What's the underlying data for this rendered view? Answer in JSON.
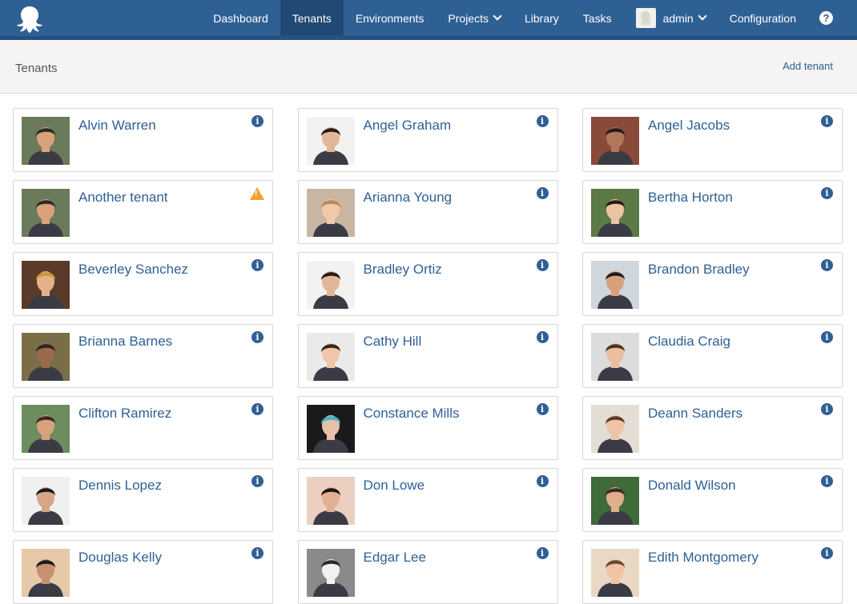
{
  "nav": {
    "items": [
      {
        "label": "Dashboard"
      },
      {
        "label": "Tenants",
        "active": true
      },
      {
        "label": "Environments"
      },
      {
        "label": "Projects",
        "dropdown": true
      },
      {
        "label": "Library"
      },
      {
        "label": "Tasks"
      }
    ],
    "user": "admin",
    "configuration": "Configuration",
    "help_icon": "help-icon",
    "logo_icon": "octopus-logo-icon"
  },
  "page": {
    "title": "Tenants",
    "add_label": "Add tenant"
  },
  "colors": {
    "nav_bg": "#2f6094",
    "nav_active": "#204a74",
    "link": "#2f6094",
    "warning": "#f0a22e"
  },
  "tenants": [
    {
      "name": "Alvin Warren",
      "status": "info",
      "bg": "#6b7a5a",
      "skin": "#d9a27c",
      "hair": "#2b2b2b"
    },
    {
      "name": "Angel Graham",
      "status": "info",
      "bg": "#f2f2f2",
      "skin": "#e5b598",
      "hair": "#2a1d17"
    },
    {
      "name": "Angel Jacobs",
      "status": "info",
      "bg": "#8a4a3a",
      "skin": "#b07858",
      "hair": "#1e1e1e"
    },
    {
      "name": "Another tenant",
      "status": "warning",
      "bg": "#6b7a5a",
      "skin": "#d9a27c",
      "hair": "#2b2b2b"
    },
    {
      "name": "Arianna Young",
      "status": "info",
      "bg": "#c9b6a2",
      "skin": "#f0c9a8",
      "hair": "#b9875a"
    },
    {
      "name": "Bertha Horton",
      "status": "info",
      "bg": "#5c7a45",
      "skin": "#eac4a3",
      "hair": "#2a1a12"
    },
    {
      "name": "Beverley Sanchez",
      "status": "info",
      "bg": "#5a3a28",
      "skin": "#e7b08a",
      "hair": "#c9993f"
    },
    {
      "name": "Bradley Ortiz",
      "status": "info",
      "bg": "#f2f2f2",
      "skin": "#e5b598",
      "hair": "#2a1d17"
    },
    {
      "name": "Brandon Bradley",
      "status": "info",
      "bg": "#cfd6dc",
      "skin": "#d8a07a",
      "hair": "#1d1d1d"
    },
    {
      "name": "Brianna Barnes",
      "status": "info",
      "bg": "#7a6e48",
      "skin": "#9a6a4a",
      "hair": "#2a2620"
    },
    {
      "name": "Cathy Hill",
      "status": "info",
      "bg": "#eaeaea",
      "skin": "#f0c6a8",
      "hair": "#3a2519"
    },
    {
      "name": "Claudia Craig",
      "status": "info",
      "bg": "#dcdcdc",
      "skin": "#e9bfa0",
      "hair": "#4a3322"
    },
    {
      "name": "Clifton Ramirez",
      "status": "info",
      "bg": "#6d8d5e",
      "skin": "#d7a17c",
      "hair": "#3b2a1f"
    },
    {
      "name": "Constance Mills",
      "status": "info",
      "bg": "#1a1a1a",
      "skin": "#e6c0a8",
      "hair": "#3fb5c9"
    },
    {
      "name": "Deann Sanders",
      "status": "info",
      "bg": "#e4ddd5",
      "skin": "#efc4a6",
      "hair": "#5a3a28"
    },
    {
      "name": "Dennis Lopez",
      "status": "info",
      "bg": "#f0f0f0",
      "skin": "#d8a684",
      "hair": "#1b1b1b"
    },
    {
      "name": "Don Lowe",
      "status": "info",
      "bg": "#eccfc0",
      "skin": "#e2b093",
      "hair": "#1e1612"
    },
    {
      "name": "Donald Wilson",
      "status": "info",
      "bg": "#3f6a3a",
      "skin": "#e0ae8c",
      "hair": "#3a2a20"
    },
    {
      "name": "Douglas Kelly",
      "status": "info",
      "bg": "#e5c9a8",
      "skin": "#c89070",
      "hair": "#1b1b1b"
    },
    {
      "name": "Edgar Lee",
      "status": "info",
      "bg": "#8a8a8a",
      "skin": "#f1f1f1",
      "hair": "#2a2a2a"
    },
    {
      "name": "Edith Montgomery",
      "status": "info",
      "bg": "#e9d8c4",
      "skin": "#efc3a4",
      "hair": "#6a4a30"
    }
  ]
}
